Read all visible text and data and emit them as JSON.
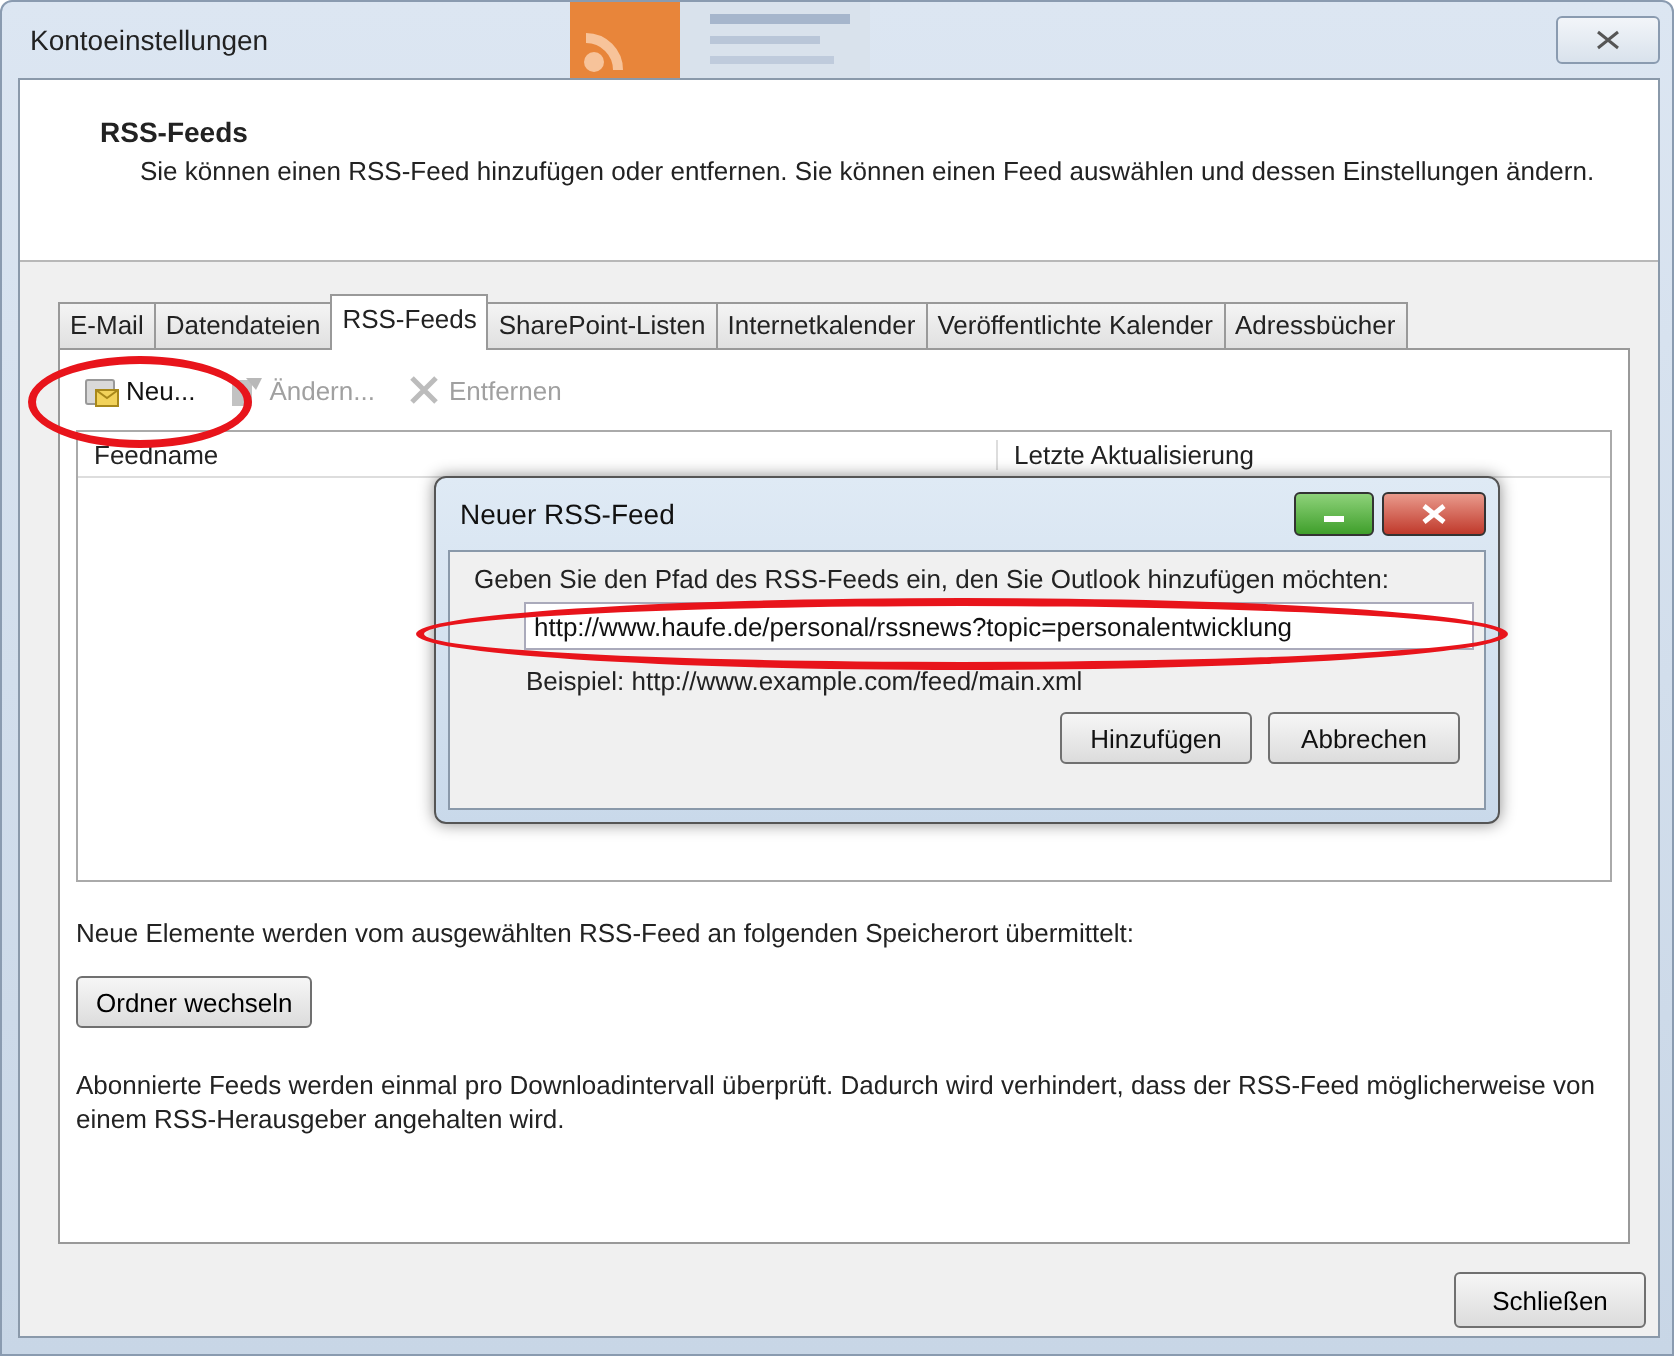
{
  "window": {
    "title": "Kontoeinstellungen"
  },
  "header": {
    "title": "RSS-Feeds",
    "description": "Sie können einen RSS-Feed hinzufügen oder entfernen. Sie können einen Feed auswählen und dessen Einstellungen ändern."
  },
  "tabs": [
    {
      "label": "E-Mail",
      "selected": false
    },
    {
      "label": "Datendateien",
      "selected": false
    },
    {
      "label": "RSS-Feeds",
      "selected": true
    },
    {
      "label": "SharePoint-Listen",
      "selected": false
    },
    {
      "label": "Internetkalender",
      "selected": false
    },
    {
      "label": "Veröffentlichte Kalender",
      "selected": false
    },
    {
      "label": "Adressbücher",
      "selected": false
    }
  ],
  "toolbar": [
    {
      "kind": "new",
      "label": "Neu...",
      "disabled": false,
      "highlight": true
    },
    {
      "kind": "edit",
      "label": "Ändern...",
      "disabled": true,
      "highlight": false
    },
    {
      "kind": "remove",
      "label": "Entfernen",
      "disabled": true,
      "highlight": false
    }
  ],
  "table": {
    "columns": [
      "Feedname",
      "Letzte Aktualisierung"
    ]
  },
  "dialog": {
    "title": "Neuer RSS-Feed",
    "prompt": "Geben Sie den Pfad des RSS-Feeds ein, den Sie Outlook hinzufügen möchten:",
    "url": {
      "value": "http://www.haufe.de/personal/rssnews?topic=personalentwicklung",
      "highlight": true
    },
    "example": "Beispiel: http://www.example.com/feed/main.xml",
    "buttons": [
      "Hinzufügen",
      "Abbrechen"
    ]
  },
  "delivery_note": "Neue Elemente werden vom ausgewählten RSS-Feed an folgenden Speicherort übermittelt:",
  "change_folder_button": "Ordner wechseln",
  "info": "Abonnierte Feeds werden einmal pro Downloadintervall überprüft. Dadurch wird verhindert, dass der RSS-Feed möglicherweise von einem RSS-Herausgeber angehalten wird.",
  "close_button": "Schließen"
}
